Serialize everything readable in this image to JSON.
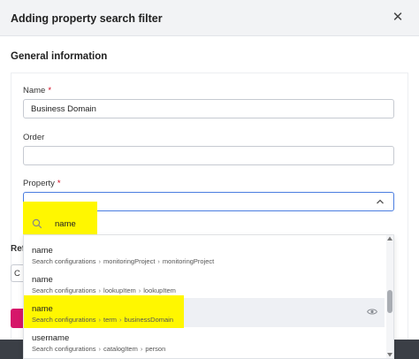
{
  "dialog": {
    "title": "Adding property search filter",
    "close_glyph": "✕"
  },
  "general": {
    "section_title": "General information",
    "name_label": "Name",
    "name_value": "Business Domain",
    "order_label": "Order",
    "order_value": "",
    "property_label": "Property",
    "required_mark": "*"
  },
  "property_dropdown": {
    "search_value": "name",
    "options": [
      {
        "name": "name",
        "path": [
          "Search configurations",
          "monitoringProject",
          "monitoringProject"
        ],
        "hovered": false
      },
      {
        "name": "name",
        "path": [
          "Search configurations",
          "lookupItem",
          "lookupItem"
        ],
        "hovered": false
      },
      {
        "name": "name",
        "path": [
          "Search configurations",
          "term",
          "businessDomain"
        ],
        "hovered": true
      },
      {
        "name": "username",
        "path": [
          "Search configurations",
          "catalogItem",
          "person"
        ],
        "hovered": false
      }
    ],
    "path_separator": "›"
  },
  "behind": {
    "section_label_fragment": "Ref",
    "input_fragment": "C"
  },
  "colors": {
    "accent_blue": "#4a7de0",
    "highlight_yellow": "#fff700",
    "primary_pink": "#d6176a",
    "required_red": "#d0021b"
  },
  "icons": {
    "close": "close-icon",
    "chevron": "chevron-up-icon",
    "search": "search-icon",
    "eye": "eye-icon"
  }
}
